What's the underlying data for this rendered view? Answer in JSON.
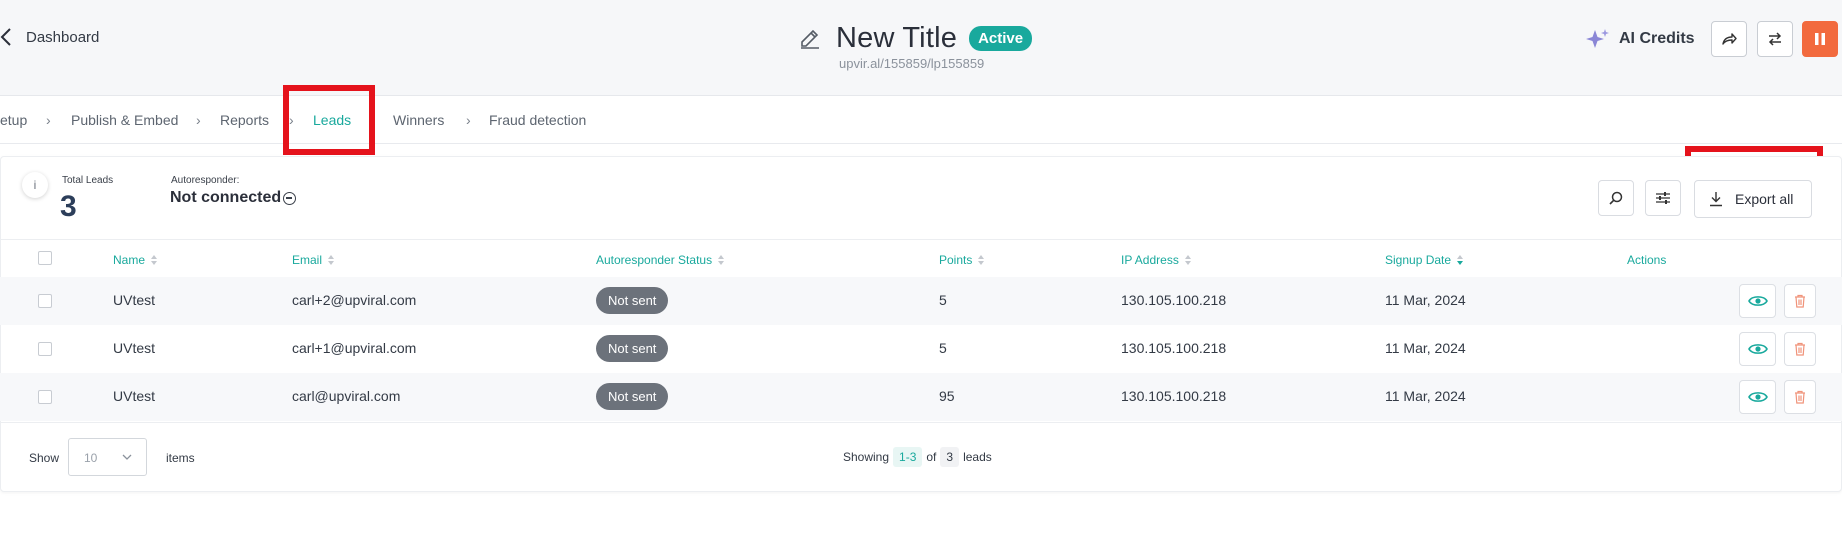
{
  "header": {
    "back_label": "Dashboard",
    "title": "New Title",
    "status_badge": "Active",
    "url": "upvir.al/155859/lp155859",
    "ai_credits_label": "AI Credits",
    "colors": {
      "accent": "#19a99d",
      "pause_button": "#f26a3e",
      "highlight_box": "#e5131c"
    }
  },
  "steps": [
    {
      "label": "etup"
    },
    {
      "label": "Publish & Embed"
    },
    {
      "label": "Reports"
    },
    {
      "label": "Leads",
      "active": true
    },
    {
      "label": "Winners"
    },
    {
      "label": "Fraud detection"
    }
  ],
  "summary": {
    "total_leads_label": "Total Leads",
    "total_leads_value": "3",
    "autoresponder_label": "Autoresponder:",
    "autoresponder_value": "Not connected"
  },
  "toolbar": {
    "export_label": "Export all"
  },
  "table": {
    "columns": [
      "Name",
      "Email",
      "Autoresponder Status",
      "Points",
      "IP Address",
      "Signup Date",
      "Actions"
    ],
    "rows": [
      {
        "name": "UVtest",
        "email": "carl+2@upviral.com",
        "status": "Not sent",
        "points": "5",
        "ip": "130.105.100.218",
        "date": "11 Mar, 2024"
      },
      {
        "name": "UVtest",
        "email": "carl+1@upviral.com",
        "status": "Not sent",
        "points": "5",
        "ip": "130.105.100.218",
        "date": "11 Mar, 2024"
      },
      {
        "name": "UVtest",
        "email": "carl@upviral.com",
        "status": "Not sent",
        "points": "95",
        "ip": "130.105.100.218",
        "date": "11 Mar, 2024"
      }
    ]
  },
  "footer": {
    "show_label": "Show",
    "page_size": "10",
    "items_label": "items",
    "showing_label": "Showing",
    "range": "1-3",
    "of_label": "of",
    "total": "3",
    "leads_label": "leads"
  }
}
